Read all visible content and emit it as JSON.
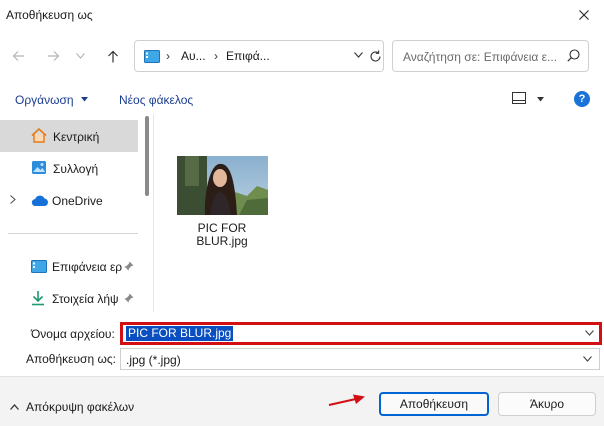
{
  "window": {
    "title": "Αποθήκευση ως"
  },
  "address": {
    "crumbs": [
      "Αυ...",
      "Επιφά..."
    ]
  },
  "search": {
    "placeholder": "Αναζήτηση σε: Επιφάνεια ε..."
  },
  "toolbar": {
    "organize": "Οργάνωση",
    "new_folder": "Νέος φάκελος"
  },
  "sidebar": {
    "items": [
      {
        "label": "Κεντρική",
        "icon": "home-icon"
      },
      {
        "label": "Συλλογή",
        "icon": "gallery-icon"
      },
      {
        "label": "OneDrive",
        "icon": "onedrive-cloud-icon"
      },
      {
        "label": "Επιφάνεια ερ",
        "icon": "desktop-icon"
      },
      {
        "label": "Στοιχεία λήψ",
        "icon": "downloads-icon"
      }
    ]
  },
  "files": [
    {
      "name_line1": "PIC FOR",
      "name_line2": "BLUR.jpg"
    }
  ],
  "form": {
    "filename_label": "Όνομα αρχείου:",
    "filename_value": "PIC FOR BLUR.jpg",
    "type_label": "Αποθήκευση ως:",
    "type_value": ".jpg (*.jpg)"
  },
  "footer": {
    "hide_folders": "Απόκρυψη φακέλων",
    "save": "Αποθήκευση",
    "cancel": "Άκυρο"
  },
  "colors": {
    "accent": "#0064d2",
    "annotation_red": "#d20f12",
    "selection": "#0a4fc1"
  }
}
